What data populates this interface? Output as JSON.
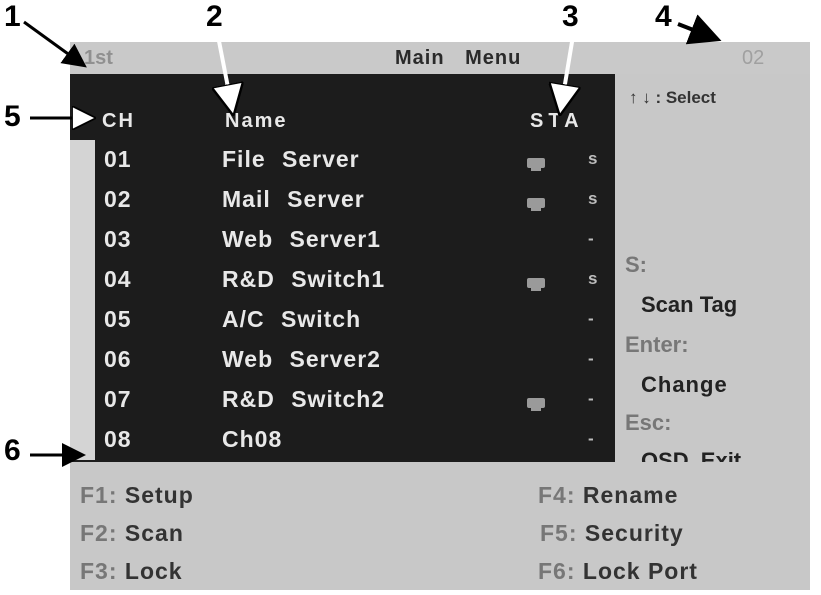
{
  "title_bar": {
    "left": "1st",
    "center": "Main Menu",
    "right": "02"
  },
  "columns": {
    "ch": "CH",
    "name": "Name",
    "sta": "STA"
  },
  "rows": [
    {
      "ch": "01",
      "name": "File Server",
      "s": "s",
      "monitor": true
    },
    {
      "ch": "02",
      "name": "Mail Server",
      "s": "s",
      "monitor": true
    },
    {
      "ch": "03",
      "name": "Web Server1",
      "s": "-",
      "monitor": false
    },
    {
      "ch": "04",
      "name": "R&D Switch1",
      "s": "s",
      "monitor": true
    },
    {
      "ch": "05",
      "name": "A/C Switch",
      "s": "-",
      "monitor": false
    },
    {
      "ch": "06",
      "name": "Web Server2",
      "s": "-",
      "monitor": false
    },
    {
      "ch": "07",
      "name": "R&D Switch2",
      "s": "-",
      "monitor": true
    },
    {
      "ch": "08",
      "name": "Ch08",
      "s": "-",
      "monitor": false
    }
  ],
  "side_panel": {
    "select_hint": "↑ ↓ : Select",
    "s_label": "S:",
    "s_value": "Scan Tag",
    "enter_label": "Enter:",
    "enter_value": "Change",
    "esc_label": "Esc:",
    "esc_value": "OSD Exit"
  },
  "function_keys": [
    {
      "key": "F1:",
      "label": "Setup"
    },
    {
      "key": "F2:",
      "label": "Scan"
    },
    {
      "key": "F3:",
      "label": "Lock"
    },
    {
      "key": "F4:",
      "label": "Rename"
    },
    {
      "key": "F5:",
      "label": "Security"
    },
    {
      "key": "F6:",
      "label": "Lock Port"
    }
  ],
  "callouts": [
    "1",
    "2",
    "3",
    "4",
    "5",
    "6"
  ],
  "colors": {
    "list_bg": "#1c1c1c",
    "panel_bg": "#c8c8c8",
    "text_light": "#e8e8e8"
  }
}
